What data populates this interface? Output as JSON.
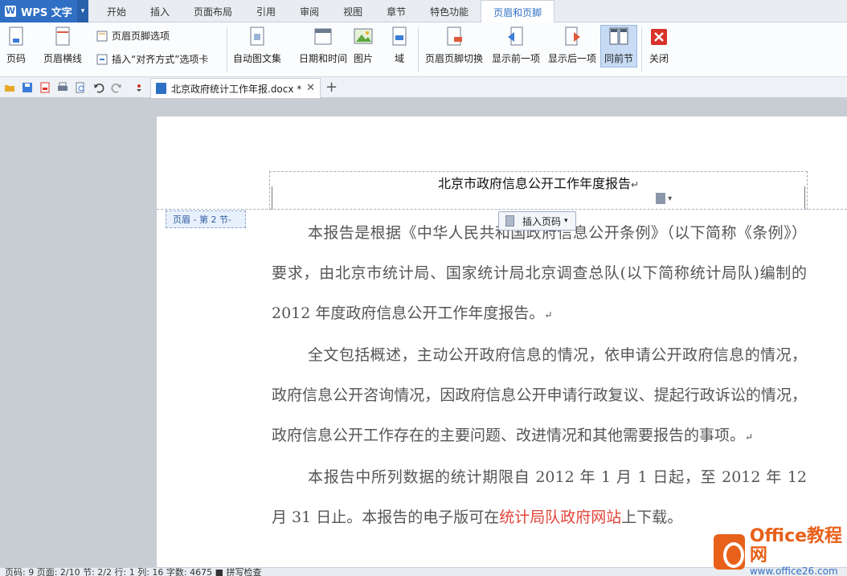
{
  "app": {
    "name": "WPS 文字"
  },
  "tabs": [
    "开始",
    "插入",
    "页面布局",
    "引用",
    "审阅",
    "视图",
    "章节",
    "特色功能",
    "页眉和页脚"
  ],
  "active_tab": "页眉和页脚",
  "ribbon": {
    "page_number": "页码",
    "header_line": "页眉横线",
    "hf_options": "页眉页脚选项",
    "insert_align_tab": "插入“对齐方式”选项卡",
    "auto_text": "自动图文集",
    "date_time": "日期和时间",
    "picture": "图片",
    "field": "域",
    "switch": "页眉页脚切换",
    "show_prev": "显示前一项",
    "show_next": "显示后一项",
    "same_as_prev": "同前节",
    "close": "关闭"
  },
  "doc_tab": {
    "name": "北京政府统计工作年报.docx *"
  },
  "header": {
    "title": "北京市政府信息公开工作年度报告",
    "label": "页眉 - 第 2 节-",
    "insert_page_number": "插入页码"
  },
  "body": {
    "p1": "本报告是根据《中华人民共和国政府信息公开条例》（以下简称《条例》）要求，由北京市统计局、国家统计局北京调查总队(以下简称统计局队)编制的 2012 年度政府信息公开工作年度报告。",
    "p2": "全文包括概述，主动公开政府信息的情况，依申请公开政府信息的情况，政府信息公开咨询情况，因政府信息公开申请行政复议、提起行政诉讼的情况，政府信息公开工作存在的主要问题、改进情况和其他需要报告的事项。",
    "p3a": "本报告中所列数据的统计期限自 2012 年 1 月 1 日起，至 2012 年 12 月 31 日止。本报告的电子版可在",
    "p3_link": "统计局队政府网站",
    "p3b": "上下载。",
    "para_mark": "↵"
  },
  "status": {
    "text": "页码: 9   页面: 2/10   节: 2/2   行: 1   列: 16   字数: 4675   ■ 拼写检查"
  },
  "watermark": {
    "brand": "Office教程网",
    "url": "www.office26.com"
  }
}
